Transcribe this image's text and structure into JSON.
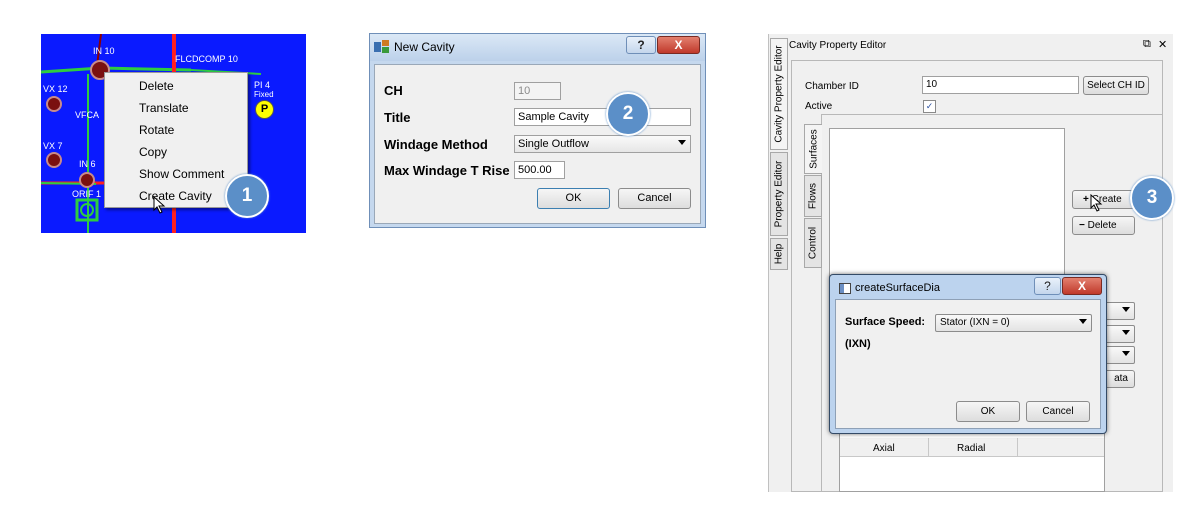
{
  "badges": [
    "1",
    "2",
    "3"
  ],
  "canvas": {
    "labels": {
      "in10": "IN 10",
      "flcdcomp": "FLCDCOMP 10",
      "vx12": "VX 12",
      "pi4": "PI 4",
      "fixed": "Fixed",
      "vfca": "VFCA",
      "vx7": "VX 7",
      "in6": "IN 6",
      "orif": "ORIF 1"
    },
    "p_marker": "P"
  },
  "context_menu": {
    "items": [
      "Delete",
      "Translate",
      "Rotate",
      "Copy",
      "Show Comment",
      "Create Cavity"
    ]
  },
  "new_cavity_dialog": {
    "title": "New Cavity",
    "help_button": "?",
    "close_button": "X",
    "fields": {
      "ch_label": "CH",
      "ch_value": "10",
      "title_label": "Title",
      "title_value": "Sample Cavity",
      "windage_label": "Windage Method",
      "windage_value": "Single Outflow",
      "max_label": "Max Windage T Rise",
      "max_value": "500.00"
    },
    "ok": "OK",
    "cancel": "Cancel"
  },
  "editor": {
    "title": "Cavity Property Editor",
    "restore_icon": "⧉",
    "close_icon": "✕",
    "side_tabs": [
      "Cavity Property Editor",
      "Property Editor",
      "Help"
    ],
    "chamber_label": "Chamber ID",
    "chamber_value": "10",
    "select_button": "Select CH ID",
    "active_label": "Active",
    "active_checked": "✓",
    "inner_tabs": [
      "Surfaces",
      "Flows",
      "Control"
    ],
    "create_button": "Create",
    "delete_button": "Delete",
    "data_button_fragment": "ata",
    "table_headers": [
      "Axial",
      "Radial"
    ]
  },
  "surface_dialog": {
    "title": "createSurfaceDia",
    "help_button": "?",
    "close_button": "X",
    "speed_label": "Surface Speed:",
    "speed_value": "Stator (IXN = 0)",
    "ixn_label": "(IXN)",
    "ok": "OK",
    "cancel": "Cancel"
  },
  "colors": {
    "canvas_blue": "#0a1aff",
    "badge_blue": "#5b8fc8",
    "close_red": "#c9443a"
  }
}
